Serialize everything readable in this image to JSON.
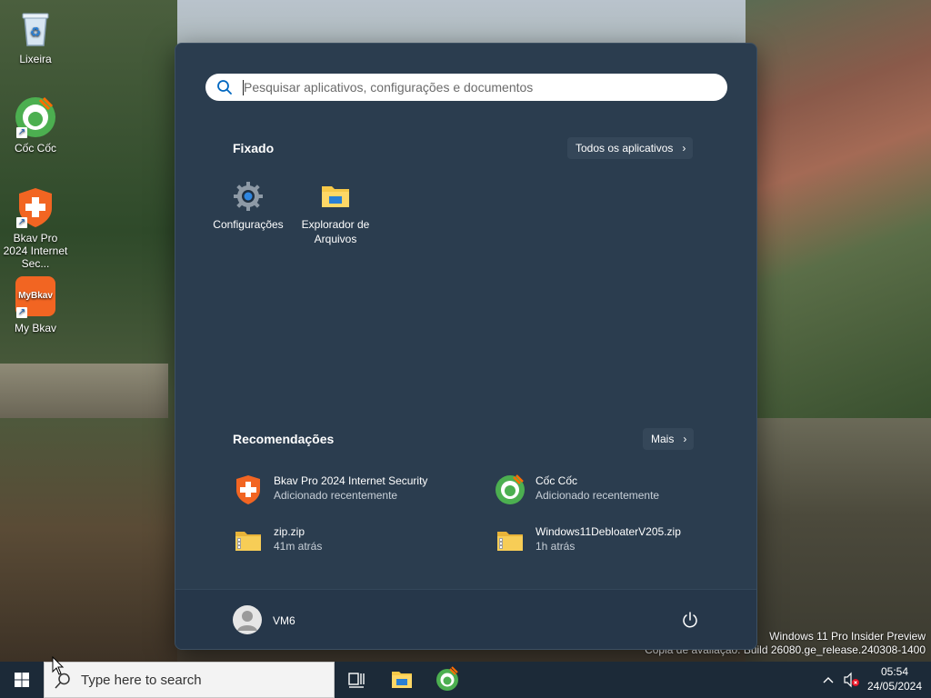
{
  "desktop": {
    "icons": [
      {
        "label": "Lixeira"
      },
      {
        "label": "Cốc Cốc"
      },
      {
        "label": "Bkav Pro 2024 Internet Sec..."
      },
      {
        "label": "My Bkav"
      }
    ],
    "mybkav_logo_text": "MyBkav",
    "watermark": {
      "line1": "Windows 11 Pro Insider Preview",
      "line2": "Cópia de avaliação. Build 26080.ge_release.240308-1400"
    }
  },
  "start_menu": {
    "search": {
      "placeholder": "Pesquisar aplicativos, configurações e documentos"
    },
    "pinned": {
      "title": "Fixado",
      "all_apps_label": "Todos os aplicativos",
      "items": [
        {
          "label": "Configurações",
          "icon": "gear-icon"
        },
        {
          "label": "Explorador de Arquivos",
          "icon": "folder-icon"
        }
      ]
    },
    "recommended": {
      "title": "Recomendações",
      "more_label": "Mais",
      "items": [
        {
          "name": "Bkav Pro 2024 Internet Security",
          "sub": "Adicionado recentemente",
          "icon": "bkav-shield-icon"
        },
        {
          "name": "Cốc Cốc",
          "sub": "Adicionado recentemente",
          "icon": "coccoc-icon"
        },
        {
          "name": "zip.zip",
          "sub": "41m atrás",
          "icon": "zip-folder-icon"
        },
        {
          "name": "Windows11DebloaterV205.zip",
          "sub": "1h atrás",
          "icon": "zip-folder-icon"
        }
      ]
    },
    "user": {
      "name": "VM6"
    }
  },
  "taskbar": {
    "search_text": "Type here to search",
    "time": "05:54",
    "date": "24/05/2024"
  },
  "colors": {
    "start_bg": "#2b3d4f",
    "footer_bg": "#26374a",
    "taskbar_bg": "#1c2a38",
    "accent_blue": "#0078d4"
  }
}
